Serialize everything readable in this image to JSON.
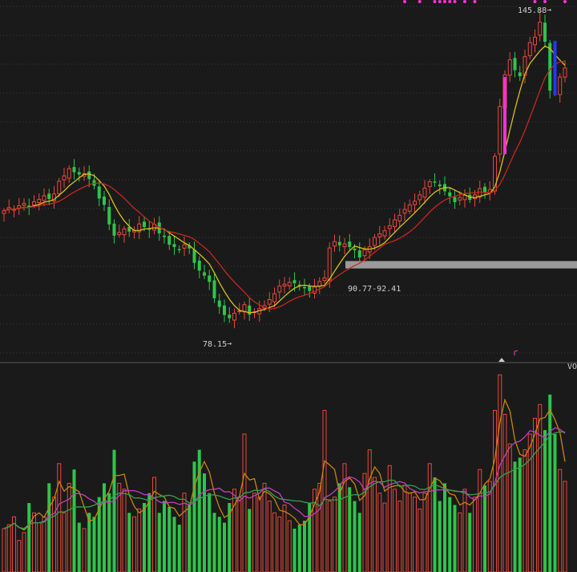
{
  "colors": {
    "background": "#1a1a1a",
    "grid": "#3a3a3a",
    "up": "#e8483c",
    "down": "#2ec44b",
    "ma_short": "#d9c01c",
    "ma_long": "#c62820",
    "vol_ma_a": "#c8850f",
    "vol_ma_b": "#c040c0",
    "vol_ma_c": "#3aa04a",
    "marker_magenta": "#ff2fd6",
    "marker_blue": "#2438ff",
    "zone": "#9a9a9a",
    "text": "#d0d0d0"
  },
  "annotations": {
    "high_label": "145.88",
    "low_label": "78.15",
    "zone_label": "90.77-92.41",
    "vol_label": "VOL"
  },
  "chart_data": [
    {
      "type": "candlestick",
      "price_range": [
        70,
        150
      ],
      "zone": [
        90.77,
        92.41
      ],
      "highest": 145.88,
      "lowest": 78.15,
      "closes": [
        103.5,
        104.2,
        103.8,
        104.6,
        105.1,
        104.3,
        105.5,
        106.0,
        106.8,
        106.1,
        107.2,
        110.0,
        111.2,
        112.8,
        112.0,
        111.5,
        111.7,
        110.5,
        109.0,
        106.2,
        104.8,
        100.5,
        98.0,
        98.7,
        99.5,
        98.9,
        99.2,
        100.6,
        99.9,
        99.3,
        100.5,
        98.5,
        97.7,
        96.0,
        95.5,
        94.8,
        96.0,
        95.2,
        92.0,
        90.3,
        89.2,
        87.8,
        84.2,
        82.3,
        80.5,
        79.8,
        80.9,
        81.4,
        82.8,
        80.6,
        81.2,
        81.9,
        82.6,
        83.9,
        85.2,
        86.9,
        87.3,
        87.7,
        87.5,
        86.8,
        86.4,
        85.8,
        86.7,
        87.9,
        88.7,
        95.3,
        96.7,
        95.9,
        96.2,
        95.5,
        94.8,
        93.2,
        94.9,
        95.6,
        97.6,
        98.4,
        99.1,
        100.2,
        101.5,
        102.5,
        103.8,
        104.8,
        105.6,
        107.0,
        108.5,
        109.9,
        109.7,
        108.9,
        107.8,
        106.7,
        105.4,
        106.4,
        106.9,
        105.9,
        107.0,
        108.4,
        107.5,
        108.2,
        115.5,
        126.5,
        133.5,
        136.8,
        134.5,
        133.2,
        137.5,
        140.6,
        141.8,
        145.1,
        140.8,
        130.0,
        129.5,
        133.0,
        135.0
      ]
    },
    {
      "type": "bar",
      "name": "VOL",
      "volumes": [
        22,
        24,
        28,
        16,
        20,
        35,
        30,
        25,
        28,
        45,
        38,
        55,
        30,
        45,
        52,
        25,
        22,
        30,
        28,
        38,
        45,
        40,
        62,
        45,
        42,
        30,
        28,
        32,
        35,
        40,
        48,
        30,
        36,
        33,
        28,
        24,
        40,
        34,
        56,
        62,
        50,
        40,
        30,
        28,
        25,
        35,
        42,
        38,
        70,
        32,
        40,
        38,
        45,
        36,
        30,
        28,
        34,
        26,
        22,
        24,
        26,
        35,
        42,
        45,
        82,
        36,
        38,
        45,
        55,
        43,
        36,
        30,
        50,
        62,
        48,
        40,
        35,
        54,
        42,
        36,
        44,
        40,
        38,
        32,
        40,
        55,
        48,
        36,
        45,
        38,
        34,
        30,
        42,
        30,
        38,
        52,
        44,
        46,
        82,
        100,
        80,
        65,
        56,
        58,
        62,
        70,
        78,
        85,
        72,
        90,
        70,
        52,
        46
      ]
    }
  ]
}
